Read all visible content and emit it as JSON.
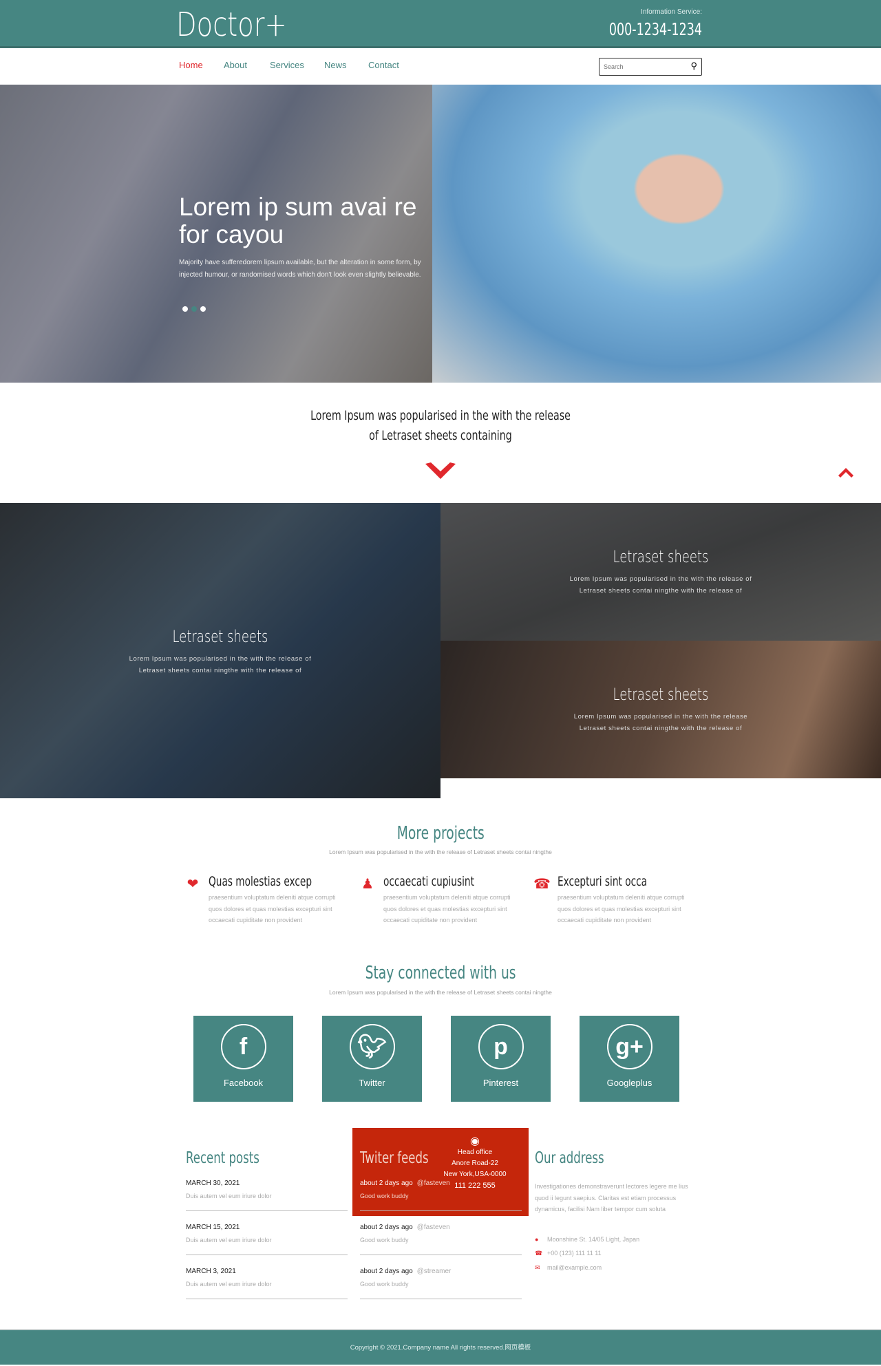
{
  "header": {
    "logo": "Doctor+",
    "info_label": "Information Service:",
    "phone": "000-1234-1234",
    "accent": "#468682"
  },
  "nav": {
    "items": [
      "Home",
      "About",
      "Services",
      "News",
      "Contact"
    ],
    "active": "Home",
    "search_placeholder": "Search",
    "search_icon": "magnifier"
  },
  "hero": {
    "title": "Lorem ip sum avai re for cayou",
    "text": "Majority have sufferedorem lipsum available, but the alteration in some form, by injected humour, or randomised words which don't look even slightly believable.",
    "slides": 3,
    "active_slide": 2
  },
  "tagline": {
    "line1": "Lorem Ipsum was popularised in the with the release",
    "line2": "of Letraset sheets containing"
  },
  "tiles": [
    {
      "title": "Letraset sheets",
      "line1": "Lorem Ipsum was popularised in the with the release of",
      "line2": "Letraset sheets contai ningthe with the release of"
    },
    {
      "title": "Letraset sheets",
      "line1": "Lorem Ipsum was popularised in the with the release of",
      "line2": "Letraset sheets contai ningthe with the release of"
    },
    {
      "title": "Letraset sheets",
      "line1": "Lorem Ipsum was popularised in the with the release",
      "line2": "Letraset sheets contai ningthe with the release of"
    }
  ],
  "projects": {
    "title": "More projects",
    "subtitle": "Lorem Ipsum was popularised in the with the release of Letraset sheets contai ningthe",
    "items": [
      {
        "icon": "heart-pulse",
        "title": "Quas molestias excep",
        "l1": "praesentium voluptatum deleniti atque corrupti",
        "l2": "quos dolores et quas molestias excepturi sint",
        "l3": "occaecati cupiditate non provident"
      },
      {
        "icon": "doctor",
        "title": "occaecati cupiusint",
        "l1": "praesentium voluptatum deleniti atque corrupti",
        "l2": "quos dolores et quas molestias excepturi sint",
        "l3": "occaecati cupiditate non provident"
      },
      {
        "icon": "phone-chat",
        "title": "Excepturi sint occa",
        "l1": "praesentium voluptatum deleniti atque corrupti",
        "l2": "quos dolores et quas molestias excepturi sint",
        "l3": "occaecati cupiditate non provident"
      }
    ]
  },
  "social": {
    "title": "Stay connected with us",
    "subtitle": "Lorem Ipsum was popularised in the with the release of Letraset sheets contai ningthe",
    "items": [
      {
        "label": "Facebook",
        "glyph": "f"
      },
      {
        "label": "Twitter",
        "glyph": "t"
      },
      {
        "label": "Pinterest",
        "glyph": "p"
      },
      {
        "label": "Googleplus",
        "glyph": "g+"
      }
    ]
  },
  "recent": {
    "title": "Recent posts",
    "posts": [
      {
        "date": "MARCH 30, 2021",
        "text": "Duis autem vel eum iriure dolor"
      },
      {
        "date": "MARCH 15, 2021",
        "text": "Duis autem vel eum iriure dolor"
      },
      {
        "date": "MARCH 3, 2021",
        "text": "Duis autem vel eum iriure dolor"
      }
    ]
  },
  "twitter": {
    "title": "Twiter feeds",
    "posts": [
      {
        "time": "about 2 days ago",
        "handle": "@fasteven",
        "text": "Good work buddy"
      },
      {
        "time": "about 2 days ago",
        "handle": "@fasteven",
        "text": "Good work buddy"
      },
      {
        "time": "about 2 days ago",
        "handle": "@streamer",
        "text": "Good work buddy"
      }
    ]
  },
  "popup": {
    "l1": "Head office",
    "l2": "Anore Road-22",
    "l3": "New York,USA-0000",
    "l4": "111 222 555",
    "color": "#c5260b"
  },
  "address": {
    "title": "Our address",
    "text": "Investigationes demonstraverunt lectores legere me lius quod ii legunt saepius. Claritas est etiam processus dynamicus, facilisi Nam liber tempor cum soluta",
    "street": "Moonshine St. 14/05 Light, Japan",
    "phone": "+00 (123) 111 11 11",
    "email": "mail@example.com"
  },
  "footer": {
    "copyright": "Copyright © 2021.Company name All rights reserved.网页模板"
  }
}
